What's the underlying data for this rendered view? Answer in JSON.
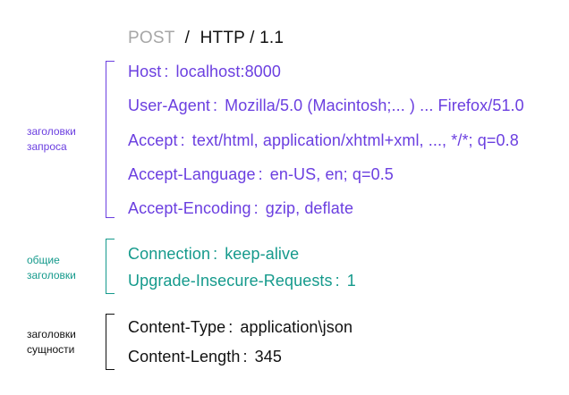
{
  "request_line": {
    "method": "POST",
    "path": "/",
    "version": "HTTP / 1.1"
  },
  "groups": {
    "request_headers": {
      "label": "заголовки\nзапроса",
      "color": "#6b3fe0",
      "items": [
        {
          "name": "Host",
          "value": "localhost:8000"
        },
        {
          "name": "User-Agent",
          "value": "Mozilla/5.0  (Macintosh;... ) ... Firefox/51.0"
        },
        {
          "name": "Accept",
          "value": "text/html, application/xhtml+xml, ..., */*; q=0.8"
        },
        {
          "name": "Accept-Language",
          "value": "en-US, en; q=0.5"
        },
        {
          "name": "Accept-Encoding",
          "value": "gzip, deflate"
        }
      ]
    },
    "general_headers": {
      "label": "общие\nзаголовки",
      "color": "#159a8c",
      "items": [
        {
          "name": "Connection",
          "value": "keep-alive"
        },
        {
          "name": "Upgrade-Insecure-Requests",
          "value": "1"
        }
      ]
    },
    "entity_headers": {
      "label": "заголовки\nсущности",
      "color": "#111111",
      "items": [
        {
          "name": "Content-Type",
          "value": "application\\json"
        },
        {
          "name": "Content-Length",
          "value": "345"
        }
      ]
    }
  }
}
